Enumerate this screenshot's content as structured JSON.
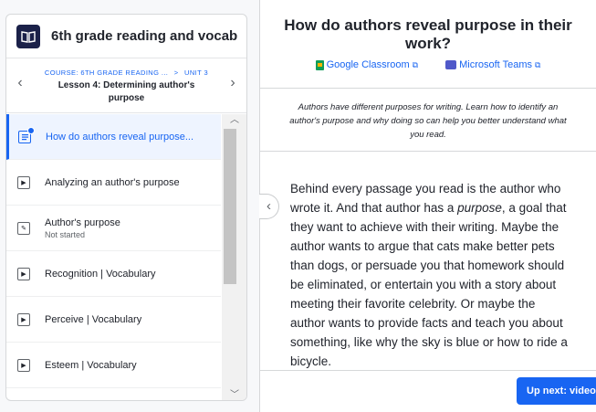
{
  "sidebar": {
    "course_title": "6th grade reading and vocab",
    "breadcrumb": {
      "course": "COURSE: 6TH GRADE READING ...",
      "separator": ">",
      "unit": "UNIT 3"
    },
    "lesson_title": "Lesson 4: Determining author's purpose",
    "items": [
      {
        "label": "How do authors reveal purpose...",
        "icon": "article-icon",
        "sub": "",
        "active": true
      },
      {
        "label": "Analyzing an author's purpose",
        "icon": "video-icon",
        "sub": "",
        "active": false
      },
      {
        "label": "Author's purpose",
        "icon": "exercise-icon",
        "sub": "Not started",
        "active": false
      },
      {
        "label": "Recognition | Vocabulary",
        "icon": "video-icon",
        "sub": "",
        "active": false
      },
      {
        "label": "Perceive | Vocabulary",
        "icon": "video-icon",
        "sub": "",
        "active": false
      },
      {
        "label": "Esteem | Vocabulary",
        "icon": "video-icon",
        "sub": "",
        "active": false
      }
    ]
  },
  "article": {
    "title": "How do authors reveal purpose in their work?",
    "share": {
      "google": "Google Classroom",
      "microsoft": "Microsoft Teams"
    },
    "description": "Authors have different purposes for writing. Learn how to identify an author's purpose and why doing so can help you better understand what you read.",
    "body_part1": "Behind every passage you read is the author who wrote it. And that author has a ",
    "body_em": "purpose",
    "body_part2": ", a goal that they want to achieve with their writing. Maybe the author wants to argue that cats make better pets than dogs, or persuade you that homework should be eliminated, or entertain you with a story about meeting their favorite celebrity. Or maybe the author wants to provide facts and teach you about something, like why the sky is blue or how to ride a bicycle.",
    "up_next": "Up next: video"
  },
  "colors": {
    "accent": "#1865f2",
    "brand_dark": "#1b2149"
  }
}
